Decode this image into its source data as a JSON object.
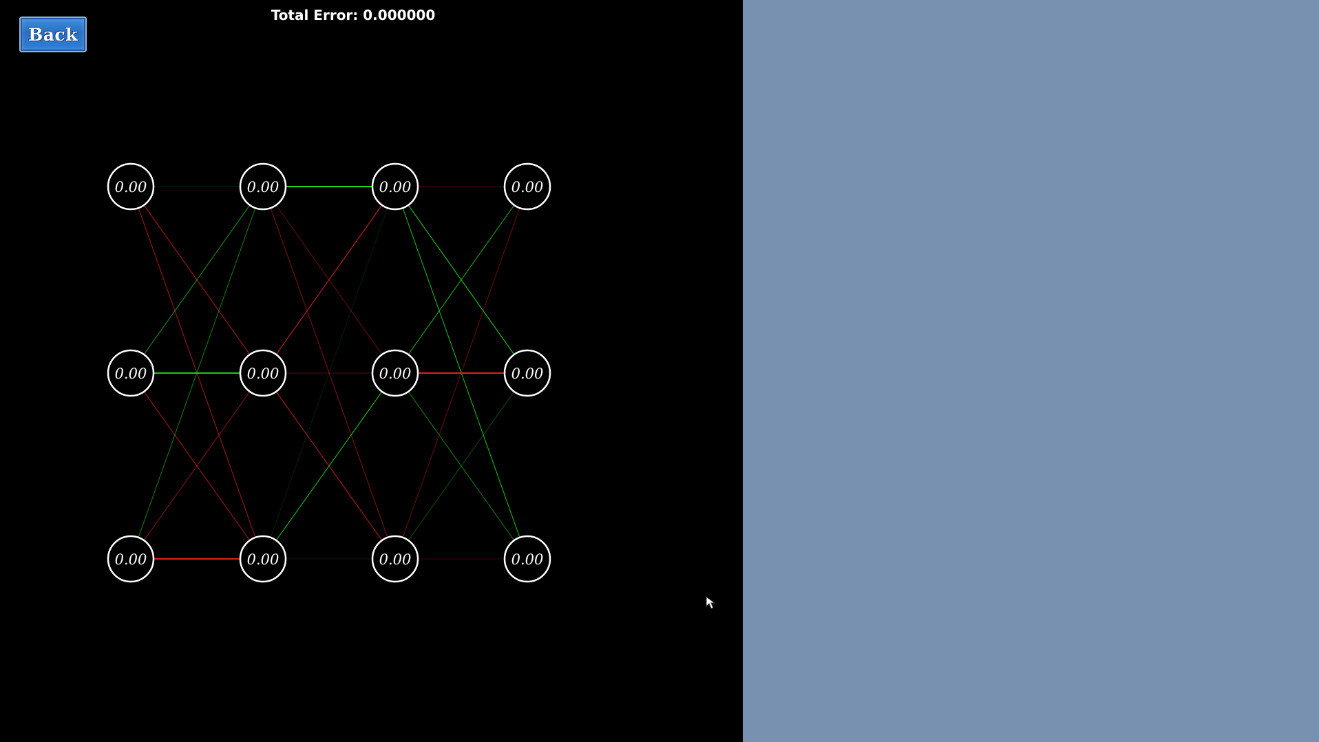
{
  "header": {
    "back_label": "Back",
    "total_error": "Total Error: 0.000000"
  },
  "colors": {
    "left_background": "#000000",
    "right_background": "#7891b1",
    "positive_weight": "#22dd22",
    "negative_weight": "#dd2222"
  },
  "network": {
    "layers": [
      [
        "0.00",
        "0.00",
        "0.00"
      ],
      [
        "0.00",
        "0.00",
        "0.00"
      ],
      [
        "0.00",
        "0.00",
        "0.00"
      ],
      [
        "0.00",
        "0.00",
        "0.00"
      ]
    ],
    "connections": [
      {
        "from": [
          0,
          0
        ],
        "to": [
          1,
          0
        ],
        "weight": 0.15
      },
      {
        "from": [
          0,
          0
        ],
        "to": [
          1,
          1
        ],
        "weight": -0.7
      },
      {
        "from": [
          0,
          0
        ],
        "to": [
          1,
          2
        ],
        "weight": -0.65
      },
      {
        "from": [
          0,
          1
        ],
        "to": [
          1,
          0
        ],
        "weight": 0.6
      },
      {
        "from": [
          0,
          1
        ],
        "to": [
          1,
          1
        ],
        "weight": 0.9
      },
      {
        "from": [
          0,
          1
        ],
        "to": [
          1,
          2
        ],
        "weight": -0.65
      },
      {
        "from": [
          0,
          2
        ],
        "to": [
          1,
          0
        ],
        "weight": 0.5
      },
      {
        "from": [
          0,
          2
        ],
        "to": [
          1,
          1
        ],
        "weight": -0.55
      },
      {
        "from": [
          0,
          2
        ],
        "to": [
          1,
          2
        ],
        "weight": -1.0
      },
      {
        "from": [
          1,
          0
        ],
        "to": [
          2,
          0
        ],
        "weight": 1.0
      },
      {
        "from": [
          1,
          0
        ],
        "to": [
          2,
          1
        ],
        "weight": -0.4
      },
      {
        "from": [
          1,
          0
        ],
        "to": [
          2,
          2
        ],
        "weight": -0.5
      },
      {
        "from": [
          1,
          1
        ],
        "to": [
          2,
          0
        ],
        "weight": -0.85
      },
      {
        "from": [
          1,
          1
        ],
        "to": [
          2,
          1
        ],
        "weight": -0.3
      },
      {
        "from": [
          1,
          1
        ],
        "to": [
          2,
          2
        ],
        "weight": -0.75
      },
      {
        "from": [
          1,
          2
        ],
        "to": [
          2,
          0
        ],
        "weight": 0.08
      },
      {
        "from": [
          1,
          2
        ],
        "to": [
          2,
          1
        ],
        "weight": 0.8
      },
      {
        "from": [
          1,
          2
        ],
        "to": [
          2,
          2
        ],
        "weight": 0.05
      },
      {
        "from": [
          2,
          0
        ],
        "to": [
          3,
          0
        ],
        "weight": -0.25
      },
      {
        "from": [
          2,
          0
        ],
        "to": [
          3,
          1
        ],
        "weight": 0.85
      },
      {
        "from": [
          2,
          0
        ],
        "to": [
          3,
          2
        ],
        "weight": 0.75
      },
      {
        "from": [
          2,
          1
        ],
        "to": [
          3,
          0
        ],
        "weight": 0.7
      },
      {
        "from": [
          2,
          1
        ],
        "to": [
          3,
          1
        ],
        "weight": -1.0
      },
      {
        "from": [
          2,
          1
        ],
        "to": [
          3,
          2
        ],
        "weight": 0.5
      },
      {
        "from": [
          2,
          2
        ],
        "to": [
          3,
          0
        ],
        "weight": -0.4
      },
      {
        "from": [
          2,
          2
        ],
        "to": [
          3,
          1
        ],
        "weight": 0.3
      },
      {
        "from": [
          2,
          2
        ],
        "to": [
          3,
          2
        ],
        "weight": -0.2
      }
    ]
  }
}
